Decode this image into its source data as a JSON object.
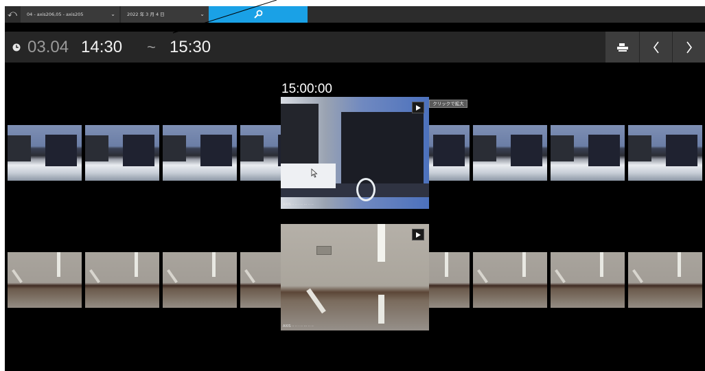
{
  "topbar": {
    "back_icon": "undo-arrow-icon",
    "camera_select_label": "04 - axis206,05 - axis205",
    "date_select_label": "2022 年 3 月 4 日",
    "search_icon": "search-icon"
  },
  "time_range": {
    "date": "03.04",
    "start": "14:30",
    "separator": "~",
    "end": "15:30"
  },
  "nav": {
    "export_icon": "export-icon",
    "prev_icon": "chevron-left-icon",
    "next_icon": "chevron-right-icon"
  },
  "main": {
    "timestamp": "15:00:00",
    "tooltip": "クリックで拡大",
    "play_icon": "play-icon"
  },
  "colors": {
    "accent": "#1aa1e6",
    "background": "#000000",
    "toolbar": "#2c2c2c"
  }
}
